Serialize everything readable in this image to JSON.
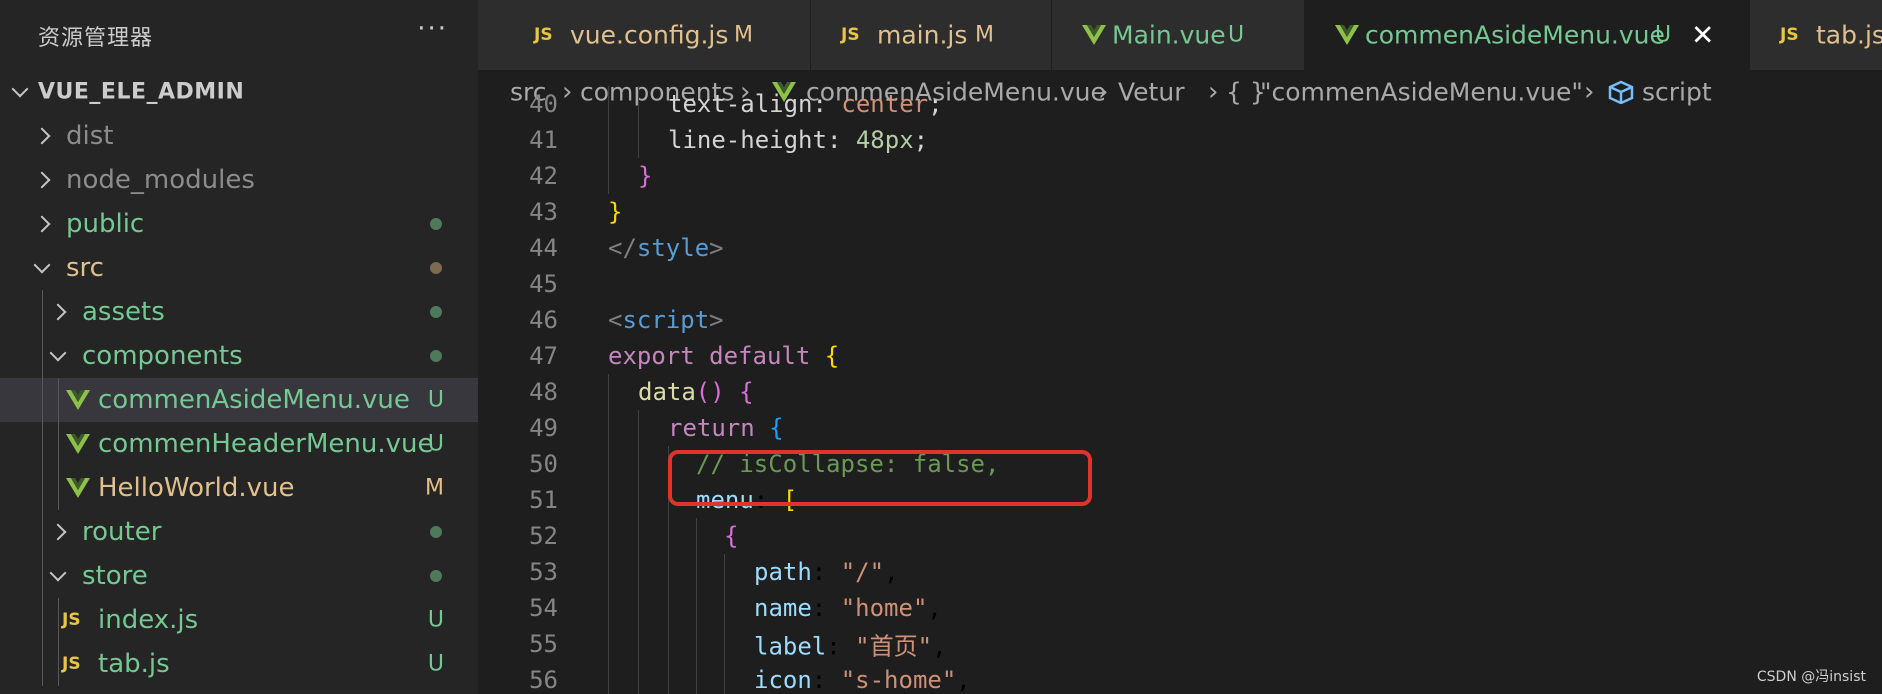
{
  "colors": {
    "sidebar_bg": "#252526",
    "editor_bg": "#1e1e1e",
    "selected_row": "#37373d",
    "untracked": "#73c991",
    "modified": "#e2c08d",
    "vue_green": "#8dc149",
    "js_yellow": "#e8c547",
    "highlight_box": "#e0342a"
  },
  "sidebar": {
    "title": "资源管理器",
    "more": "···",
    "root": "VUE_ELE_ADMIN",
    "items": [
      {
        "name": "dist",
        "badge": ""
      },
      {
        "name": "node_modules",
        "badge": ""
      },
      {
        "name": "public",
        "badge": ""
      },
      {
        "name": "src",
        "badge": ""
      },
      {
        "name": "assets",
        "badge": ""
      },
      {
        "name": "components",
        "badge": ""
      },
      {
        "name": "commenAsideMenu.vue",
        "badge": "U"
      },
      {
        "name": "commenHeaderMenu.vue",
        "badge": "U"
      },
      {
        "name": "HelloWorld.vue",
        "badge": "M"
      },
      {
        "name": "router",
        "badge": ""
      },
      {
        "name": "store",
        "badge": ""
      },
      {
        "name": "index.js",
        "badge": "U"
      },
      {
        "name": "tab.js",
        "badge": "U"
      }
    ]
  },
  "tabs": [
    {
      "icon": "JS",
      "label": "vue.config.js",
      "status": "M"
    },
    {
      "icon": "JS",
      "label": "main.js",
      "status": "M"
    },
    {
      "icon": "vue",
      "label": "Main.vue",
      "status": "U"
    },
    {
      "icon": "vue",
      "label": "commenAsideMenu.vue",
      "status": "U",
      "close": "✕"
    },
    {
      "icon": "JS",
      "label": "tab.js",
      "status": ""
    }
  ],
  "breadcrumb": {
    "seg1": "src",
    "seg2": "components",
    "seg3": "commenAsideMenu.vue",
    "seg4": "Vetur",
    "seg5_icon": "{ }",
    "seg5": "\"commenAsideMenu.vue\"",
    "seg6": "script",
    "sep": "›"
  },
  "code": {
    "lines": [
      {
        "n": "40",
        "t": [
          "text-align",
          ": ",
          "center",
          ";"
        ]
      },
      {
        "n": "41",
        "t": [
          "line-height",
          ": ",
          "48px",
          ";"
        ]
      },
      {
        "n": "42",
        "t": [
          "}"
        ]
      },
      {
        "n": "43",
        "t": [
          "}"
        ]
      },
      {
        "n": "44",
        "t": [
          "</",
          "style",
          ">"
        ]
      },
      {
        "n": "45",
        "t": []
      },
      {
        "n": "46",
        "t": [
          "<",
          "script",
          ">"
        ]
      },
      {
        "n": "47",
        "t": [
          "export",
          " ",
          "default",
          " ",
          "{"
        ]
      },
      {
        "n": "48",
        "t": [
          "data",
          "()",
          " ",
          "{"
        ]
      },
      {
        "n": "49",
        "t": [
          "return",
          " ",
          "{"
        ]
      },
      {
        "n": "50",
        "t": [
          "// isCollapse: false,"
        ]
      },
      {
        "n": "51",
        "t": [
          "menu",
          ": ",
          "["
        ]
      },
      {
        "n": "52",
        "t": [
          "{"
        ]
      },
      {
        "n": "53",
        "t": [
          "path",
          ": ",
          "\"/\"",
          ","
        ]
      },
      {
        "n": "54",
        "t": [
          "name",
          ": ",
          "\"home\"",
          ","
        ]
      },
      {
        "n": "55",
        "t": [
          "label",
          ": ",
          "\"首页\"",
          ","
        ]
      },
      {
        "n": "56",
        "t": [
          "icon",
          ": ",
          "\"s-home\"",
          ","
        ]
      }
    ]
  },
  "watermark": "CSDN @冯insist"
}
